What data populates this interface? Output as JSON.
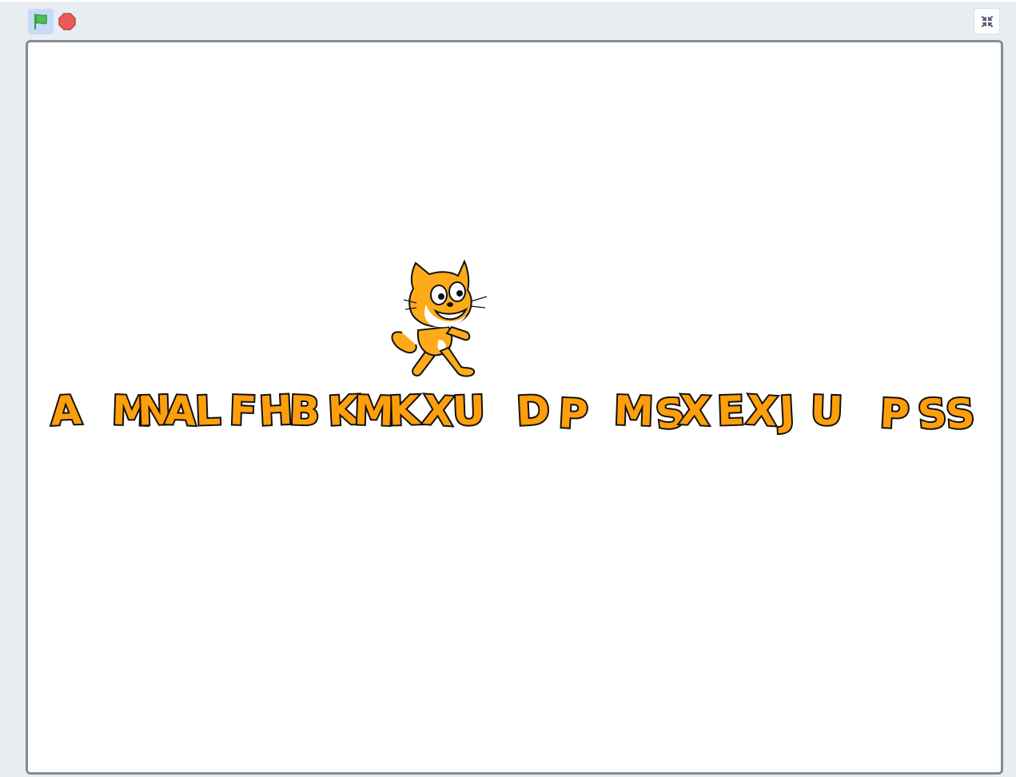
{
  "toolbar": {
    "green_flag_icon": "green-flag-icon",
    "stop_icon": "stop-icon",
    "fullscreen_icon": "unfullscreen-icon"
  },
  "colors": {
    "flag_green": "#4cbf56",
    "stop_red": "#ec5959",
    "letter_fill": "#ff9e0b",
    "letter_outline": "#111111",
    "stage_border": "#858c96"
  },
  "stage": {
    "cat_sprite": "cat-sprite",
    "letters": [
      "A",
      "M",
      "N",
      "A",
      "L",
      "F",
      "H",
      "B",
      "K",
      "M",
      "K",
      "X",
      "U",
      "D",
      "P",
      "M",
      "S",
      "X",
      "E",
      "X",
      "J",
      "U",
      "P",
      "S",
      "S"
    ]
  }
}
